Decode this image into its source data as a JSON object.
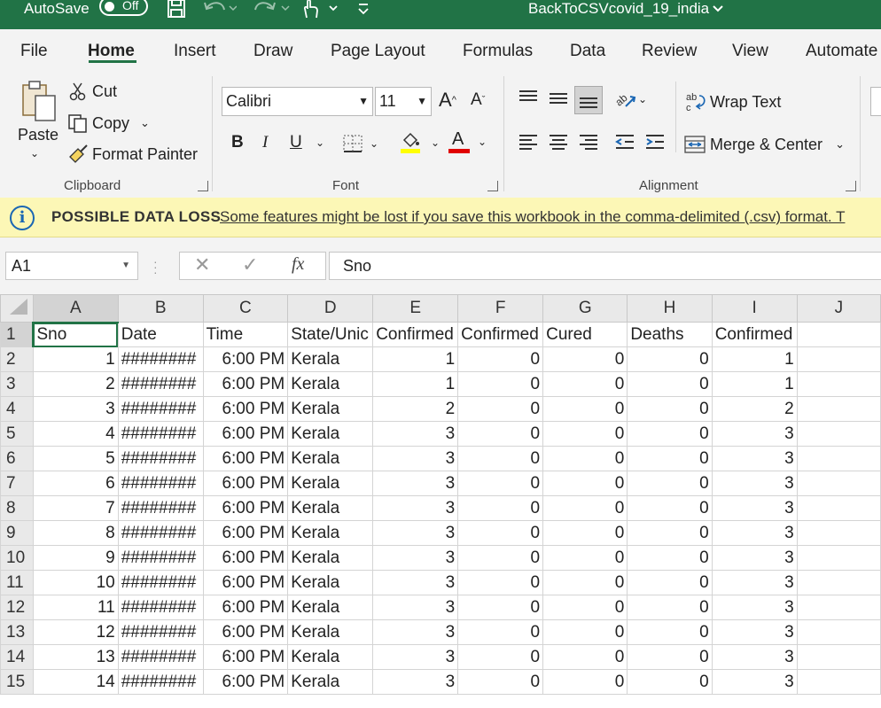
{
  "titlebar": {
    "autosave_label": "AutoSave",
    "autosave_state": "Off",
    "doc_title": "BackToCSVcovid_19_india",
    "brand_color": "#217346"
  },
  "tabs": [
    "File",
    "Home",
    "Insert",
    "Draw",
    "Page Layout",
    "Formulas",
    "Data",
    "Review",
    "View",
    "Automate"
  ],
  "active_tab": "Home",
  "ribbon": {
    "clipboard": {
      "paste": "Paste",
      "cut": "Cut",
      "copy": "Copy",
      "format_painter": "Format Painter",
      "label": "Clipboard"
    },
    "font": {
      "name": "Calibri",
      "size": "11",
      "label": "Font",
      "bold": "B",
      "italic": "I",
      "underline": "U",
      "grow": "A",
      "shrink": "A",
      "font_color_letter": "A"
    },
    "alignment": {
      "wrap_text": "Wrap Text",
      "merge_center": "Merge & Center",
      "label": "Alignment"
    }
  },
  "message_bar": {
    "title": "POSSIBLE DATA LOSS",
    "text": "Some features might be lost if you save this workbook in the comma-delimited (.csv) format. T"
  },
  "formula_bar": {
    "name_box": "A1",
    "fx": "fx",
    "value": "Sno"
  },
  "sheet": {
    "columns": [
      "A",
      "B",
      "C",
      "D",
      "E",
      "F",
      "G",
      "H",
      "I",
      "J"
    ],
    "row_numbers": [
      "1",
      "2",
      "3",
      "4",
      "5",
      "6",
      "7",
      "8",
      "9",
      "10",
      "11",
      "12",
      "13",
      "14",
      "15"
    ],
    "header_row": [
      "Sno",
      "Date",
      "Time",
      "State/Unic",
      "Confirmed",
      "Confirmed",
      "Cured",
      "Deaths",
      "Confirmed",
      ""
    ],
    "rows": [
      [
        "1",
        "########",
        "6:00 PM",
        "Kerala",
        "1",
        "0",
        "0",
        "0",
        "1",
        ""
      ],
      [
        "2",
        "########",
        "6:00 PM",
        "Kerala",
        "1",
        "0",
        "0",
        "0",
        "1",
        ""
      ],
      [
        "3",
        "########",
        "6:00 PM",
        "Kerala",
        "2",
        "0",
        "0",
        "0",
        "2",
        ""
      ],
      [
        "4",
        "########",
        "6:00 PM",
        "Kerala",
        "3",
        "0",
        "0",
        "0",
        "3",
        ""
      ],
      [
        "5",
        "########",
        "6:00 PM",
        "Kerala",
        "3",
        "0",
        "0",
        "0",
        "3",
        ""
      ],
      [
        "6",
        "########",
        "6:00 PM",
        "Kerala",
        "3",
        "0",
        "0",
        "0",
        "3",
        ""
      ],
      [
        "7",
        "########",
        "6:00 PM",
        "Kerala",
        "3",
        "0",
        "0",
        "0",
        "3",
        ""
      ],
      [
        "8",
        "########",
        "6:00 PM",
        "Kerala",
        "3",
        "0",
        "0",
        "0",
        "3",
        ""
      ],
      [
        "9",
        "########",
        "6:00 PM",
        "Kerala",
        "3",
        "0",
        "0",
        "0",
        "3",
        ""
      ],
      [
        "10",
        "########",
        "6:00 PM",
        "Kerala",
        "3",
        "0",
        "0",
        "0",
        "3",
        ""
      ],
      [
        "11",
        "########",
        "6:00 PM",
        "Kerala",
        "3",
        "0",
        "0",
        "0",
        "3",
        ""
      ],
      [
        "12",
        "########",
        "6:00 PM",
        "Kerala",
        "3",
        "0",
        "0",
        "0",
        "3",
        ""
      ],
      [
        "13",
        "########",
        "6:00 PM",
        "Kerala",
        "3",
        "0",
        "0",
        "0",
        "3",
        ""
      ],
      [
        "14",
        "########",
        "6:00 PM",
        "Kerala",
        "3",
        "0",
        "0",
        "0",
        "3",
        ""
      ]
    ]
  }
}
